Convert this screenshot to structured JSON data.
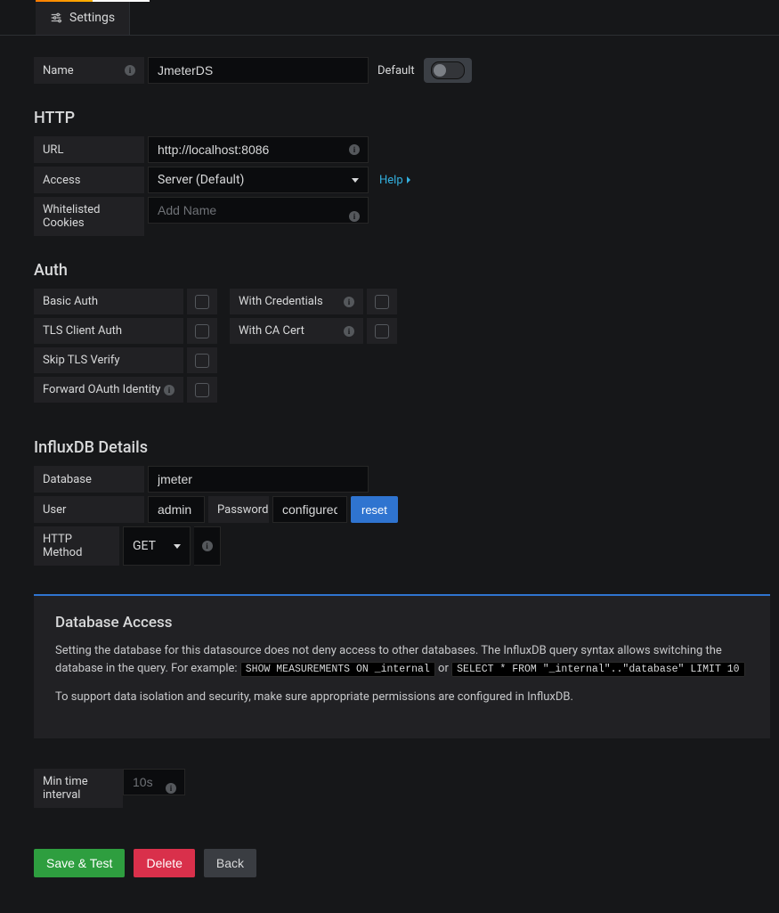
{
  "tab": {
    "label": "Settings"
  },
  "name": {
    "label": "Name",
    "value": "JmeterDS"
  },
  "default": {
    "label": "Default",
    "on": false
  },
  "http": {
    "title": "HTTP",
    "url_label": "URL",
    "url_value": "http://localhost:8086",
    "access_label": "Access",
    "access_value": "Server (Default)",
    "help": "Help",
    "cookies_label": "Whitelisted Cookies",
    "cookies_placeholder": "Add Name"
  },
  "auth": {
    "title": "Auth",
    "basic": "Basic Auth",
    "credentials": "With Credentials",
    "tls": "TLS Client Auth",
    "cacert": "With CA Cert",
    "skip": "Skip TLS Verify",
    "forward": "Forward OAuth Identity"
  },
  "influx": {
    "title": "InfluxDB Details",
    "db_label": "Database",
    "db_value": "jmeter",
    "user_label": "User",
    "user_value": "admin",
    "pwd_label": "Password",
    "pwd_value": "configured",
    "reset": "reset",
    "method_label": "HTTP Method",
    "method_value": "GET"
  },
  "panel": {
    "title": "Database Access",
    "line1": "Setting the database for this datasource does not deny access to other databases. The InfluxDB query syntax allows switching the database in the query. For example: ",
    "code1": "SHOW MEASUREMENTS ON _internal",
    "or": " or ",
    "code2": "SELECT * FROM \"_internal\"..\"database\" LIMIT 10",
    "line2": "To support data isolation and security, make sure appropriate permissions are configured in InfluxDB."
  },
  "min_interval": {
    "label": "Min time interval",
    "placeholder": "10s"
  },
  "buttons": {
    "save": "Save & Test",
    "delete": "Delete",
    "back": "Back"
  }
}
